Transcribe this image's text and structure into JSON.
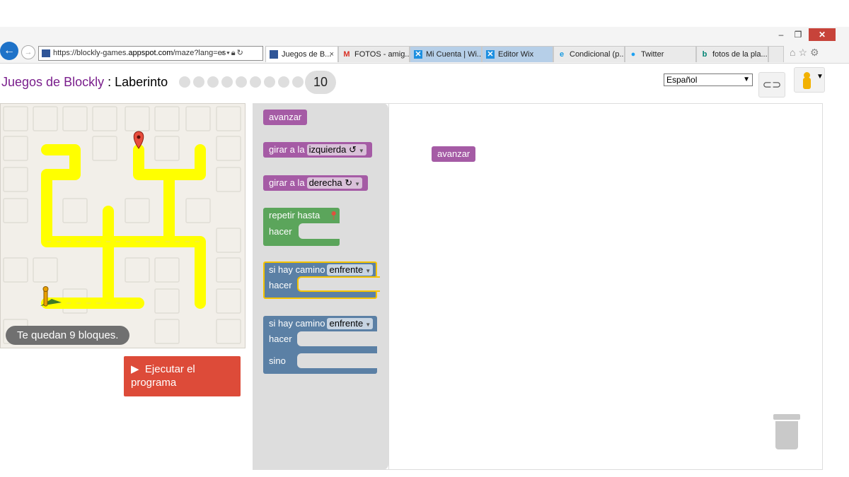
{
  "browser": {
    "url_prefix": "https://blockly-games.",
    "url_domain": "appspot.com",
    "url_suffix": "/maze?lang=es",
    "tabs": [
      {
        "label": "Juegos de B...",
        "icon": "puzzle-icon",
        "close": "×"
      },
      {
        "label": "FOTOS - amig...",
        "icon": "gmail-icon"
      },
      {
        "label": "Mi Cuenta | Wi...",
        "icon": "wix-icon"
      },
      {
        "label": "Editor Wix",
        "icon": "wix-icon"
      },
      {
        "label": "Condicional (p...",
        "icon": "ie-icon"
      },
      {
        "label": "Twitter",
        "icon": "twitter-icon"
      },
      {
        "label": "fotos de la pla...",
        "icon": "bing-icon"
      }
    ]
  },
  "header": {
    "brand": "Juegos de Blockly",
    "separator": " : ",
    "game": "Laberinto",
    "current_level": "10",
    "language": "Español"
  },
  "maze": {
    "blocks_left": "Te quedan 9 bloques."
  },
  "run_button": {
    "label": "Ejecutar el programa"
  },
  "toolbox": {
    "move_forward": "avanzar",
    "turn_prefix": "girar a la",
    "turn_left": "izquierda",
    "turn_right": "derecha",
    "repeat_until": "repetir hasta",
    "do": "hacer",
    "if_path": "si hay camino",
    "ahead": "enfrente",
    "else": "sino"
  },
  "workspace": {
    "placed_block": "avanzar"
  },
  "colors": {
    "brand": "#7a1e8c",
    "movement_block": "#a55ba5",
    "loop_block": "#5ba55b",
    "logic_block": "#5b80a5",
    "run_button": "#dd4b39",
    "path": "#ffff00"
  }
}
